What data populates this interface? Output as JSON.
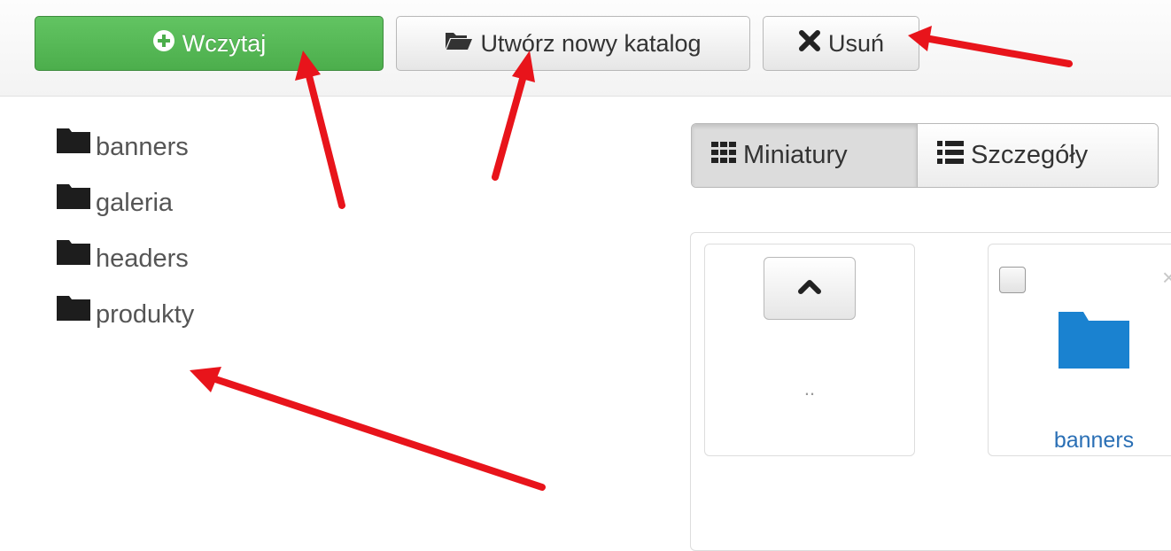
{
  "toolbar": {
    "upload_label": "Wczytaj",
    "new_folder_label": "Utwórz nowy katalog",
    "delete_label": "Usuń"
  },
  "tree": {
    "items": [
      {
        "label": "banners"
      },
      {
        "label": "galeria"
      },
      {
        "label": "headers"
      },
      {
        "label": "produkty"
      }
    ]
  },
  "view_toggle": {
    "thumbnails_label": "Miniatury",
    "details_label": "Szczegóły",
    "active": "Miniatury"
  },
  "files": {
    "parent_label": "..",
    "items": [
      {
        "name": "banners",
        "type": "folder"
      }
    ]
  },
  "colors": {
    "accent_green": "#5cb85c",
    "folder_blue": "#1a82d0",
    "link_blue": "#2a6fb5",
    "annotation_red": "#e8141b"
  },
  "icons": {
    "upload": "plus-circle-icon",
    "new_folder": "folder-open-icon",
    "delete": "x-icon",
    "thumbnails": "grid-icon",
    "details": "list-icon",
    "up": "chevron-up-icon",
    "tree_folder": "folder-icon"
  }
}
